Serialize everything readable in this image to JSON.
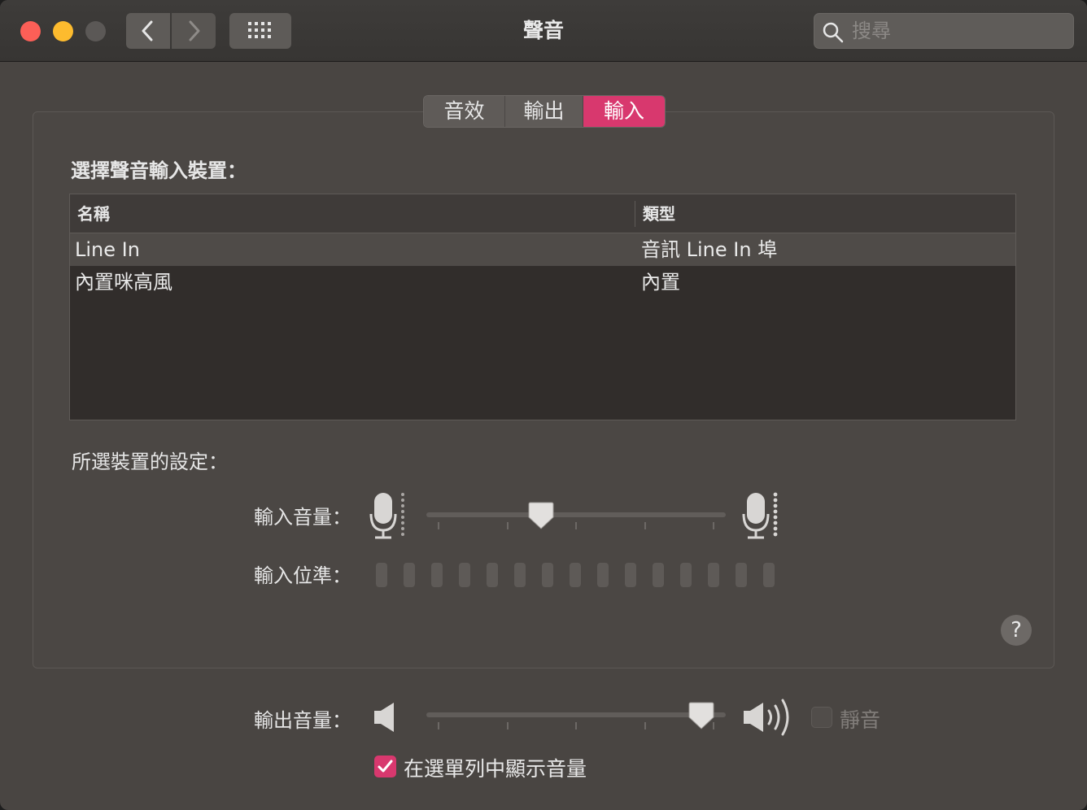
{
  "window": {
    "title": "聲音",
    "search": {
      "placeholder": "搜尋",
      "value": ""
    }
  },
  "tabs": [
    {
      "label": "音效",
      "selected": false
    },
    {
      "label": "輸出",
      "selected": false
    },
    {
      "label": "輸入",
      "selected": true
    }
  ],
  "input": {
    "device_section_label": "選擇聲音輸入裝置：",
    "columns": {
      "name": "名稱",
      "type": "類型"
    },
    "devices": [
      {
        "name": "Line In",
        "type": "音訊 Line In 埠",
        "selected": true
      },
      {
        "name": "內置咪高風",
        "type": "內置",
        "selected": false
      }
    ],
    "settings_label": "所選裝置的設定：",
    "volume_label": "輸入音量：",
    "volume_fraction": 0.37,
    "level_label": "輸入位準：",
    "level_segments_total": 15,
    "level_segments_lit": 0
  },
  "output": {
    "volume_label": "輸出音量：",
    "volume_fraction": 0.96,
    "mute_label": "靜音",
    "mute_checked": false,
    "show_in_menubar_label": "在選單列中顯示音量",
    "show_in_menubar_checked": true
  },
  "help_label": "?",
  "colors": {
    "accent": "#d8386e",
    "window_bg": "#494542"
  },
  "icons": [
    "back-chevron-icon",
    "forward-chevron-icon",
    "grid-icon",
    "search-icon",
    "microphone-icon",
    "speaker-icon",
    "checkmark-icon"
  ]
}
